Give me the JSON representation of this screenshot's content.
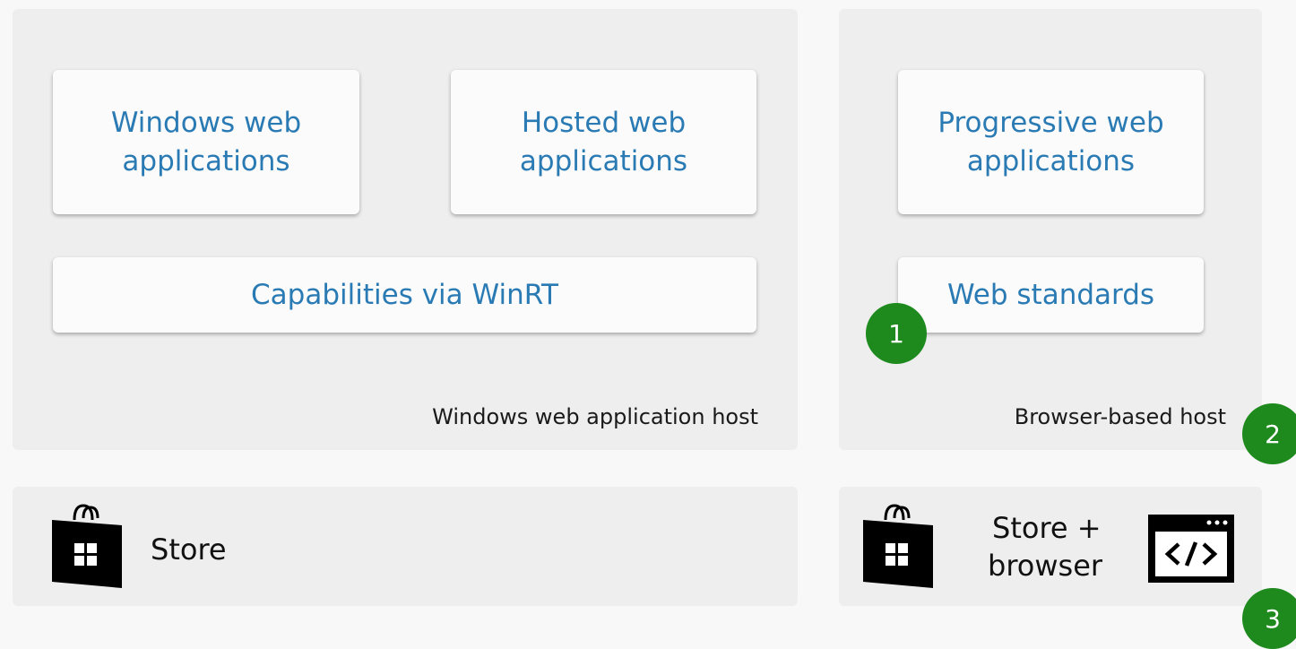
{
  "cards": {
    "windows_web_apps": "Windows web applications",
    "hosted_web_apps": "Hosted web applications",
    "capabilities": "Capabilities via WinRT",
    "progressive_web_apps": "Progressive web applications",
    "web_standards": "Web standards"
  },
  "hosts": {
    "windows_host": "Windows web application host",
    "browser_host": "Browser-based host"
  },
  "distribution": {
    "store": "Store",
    "store_plus": "Store +",
    "browser": "browser"
  },
  "badges": [
    "1",
    "2",
    "3"
  ],
  "icons": {
    "store": "windows-store-bag-icon",
    "browser_code": "browser-code-icon"
  },
  "colors": {
    "card_text": "#2a7ab4",
    "badge": "#1e8a1e",
    "panel": "#eeeeee"
  }
}
